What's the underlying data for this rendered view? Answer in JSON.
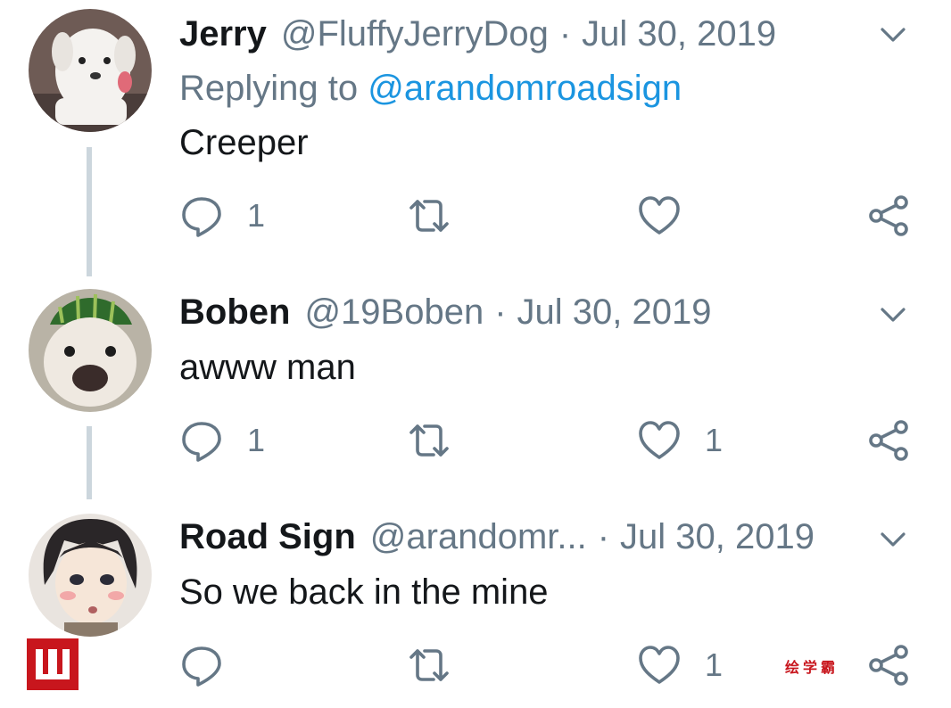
{
  "tweets": [
    {
      "name": "Jerry",
      "handle": "@FluffyJerryDog",
      "separator": "·",
      "date": "Jul 30, 2019",
      "replying_prefix": "Replying to",
      "replying_to": "@arandomroadsign",
      "text": "Creeper",
      "replies": "1",
      "retweets": "",
      "likes": ""
    },
    {
      "name": "Boben",
      "handle": "@19Boben",
      "separator": "·",
      "date": "Jul 30, 2019",
      "text": "awww man",
      "replies": "1",
      "retweets": "",
      "likes": "1"
    },
    {
      "name": "Road Sign",
      "handle": "@arandomr...",
      "separator": "·",
      "date": "Jul 30, 2019",
      "text": "So we back in the mine",
      "replies": "",
      "retweets": "",
      "likes": "1"
    }
  ],
  "watermark": {
    "text": "绘学霸"
  },
  "colors": {
    "primary_text": "#14171a",
    "secondary_text": "#657786",
    "link": "#1b95e0",
    "thread_line": "#ccd6dd",
    "watermark": "#c8161d"
  },
  "icons": [
    "reply-icon",
    "retweet-icon",
    "like-icon",
    "share-icon",
    "chevron-down-icon"
  ]
}
